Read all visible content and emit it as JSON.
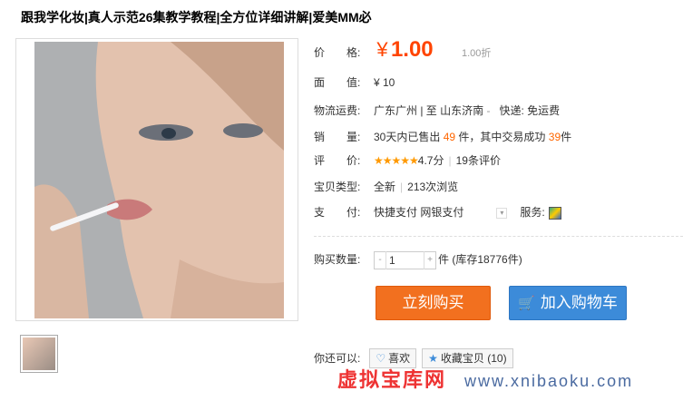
{
  "title": "跟我学化妆|真人示范26集教学教程|全方位详细讲解|爱美MM必",
  "main_image": {
    "alt_icon": "product-photo"
  },
  "labels": {
    "price": "价　　格:",
    "face_value": "面　　值:",
    "shipping": "物流运费:",
    "sales": "销　　量:",
    "rating": "评　　价:",
    "type": "宝贝类型:",
    "pay": "支　　付:",
    "qty": "购买数量:",
    "also": "你还可以:"
  },
  "price": {
    "currency": "¥",
    "value": "1.00",
    "discount": "1.00折"
  },
  "face_value": "¥ 10",
  "shipping": {
    "route": "广东广州 | 至  山东济南",
    "arrow": "-",
    "express": "快递: 免运费"
  },
  "sales": {
    "pre": "30天内已售出",
    "sold": "49",
    "mid": "件，其中交易成功",
    "success": "39",
    "post": "件"
  },
  "rating": {
    "stars": "★★★★★",
    "score": "4.7分",
    "reviews": "19条评价"
  },
  "item_type": {
    "condition": "全新",
    "views": "213次浏览"
  },
  "pay": {
    "methods": "快捷支付  网银支付",
    "service_label": "服务:"
  },
  "qty": {
    "minus": "-",
    "value": "1",
    "plus": "+",
    "stock": "件 (库存18776件)"
  },
  "buttons": {
    "buy": "立刻购买",
    "cart": "加入购物车",
    "like": "喜欢",
    "fav": "收藏宝贝 (10)"
  },
  "watermark": {
    "cn": "虚拟宝库网",
    "url": "www.xnibaoku.com"
  }
}
